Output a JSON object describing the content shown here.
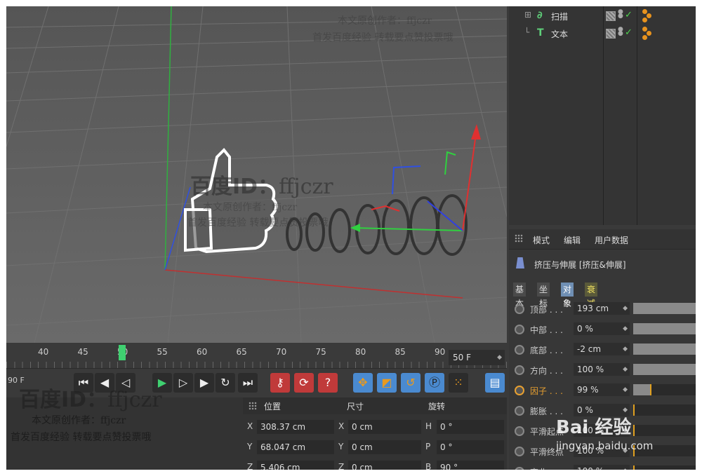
{
  "object_manager": {
    "items": [
      {
        "name": "扫描",
        "icon": "sweep-icon"
      },
      {
        "name": "文本",
        "icon": "text-icon"
      }
    ]
  },
  "attributes": {
    "menu": [
      "模式",
      "编辑",
      "用户数据"
    ],
    "title": "挤压与伸展 [挤压&伸展]",
    "tabs": [
      "基本",
      "坐标",
      "对象",
      "衰减"
    ],
    "active_tab": "对象",
    "params": [
      {
        "label": "顶部 . . .",
        "value": "193 cm"
      },
      {
        "label": "中部 . . .",
        "value": "0 %"
      },
      {
        "label": "底部 . . .",
        "value": "-2 cm"
      },
      {
        "label": "方向 . . .",
        "value": "100 %"
      },
      {
        "label": "因子 . . .",
        "value": "99 %",
        "highlight": true
      },
      {
        "label": "膨胀 . . .",
        "value": "0 %"
      },
      {
        "label": "平滑起点",
        "value": "100 %"
      },
      {
        "label": "平滑终点",
        "value": "100 %"
      },
      {
        "label": "弯曲 . . .",
        "value": "100 %"
      }
    ]
  },
  "timeline": {
    "ticks": [
      "40",
      "45",
      "50",
      "55",
      "60",
      "65",
      "70",
      "75",
      "80",
      "85",
      "90"
    ],
    "current_frame": "50",
    "end_frame": "50 F",
    "left_field": "90 F"
  },
  "coordinates": {
    "headers": [
      "位置",
      "尺寸",
      "旋转"
    ],
    "rows": [
      {
        "pos_axis": "X",
        "pos": "308.37 cm",
        "size_axis": "X",
        "size": "0 cm",
        "rot_axis": "H",
        "rot": "0 °"
      },
      {
        "pos_axis": "Y",
        "pos": "68.047 cm",
        "size_axis": "Y",
        "size": "0 cm",
        "rot_axis": "P",
        "rot": "0 °"
      },
      {
        "pos_axis": "Z",
        "pos": "5.406 cm",
        "size_axis": "Z",
        "size": "0 cm",
        "rot_axis": "B",
        "rot": "90 °"
      }
    ]
  },
  "watermark": {
    "id_label": "百度ID：",
    "id_value": "ffjczr",
    "line1": "本文原创作者：ffjczr",
    "line2": "首发百度经验  转载要点赞投票哦"
  },
  "logo": {
    "brand": "Bai  经验",
    "url": "jingyan.baidu.com"
  },
  "colors": {
    "accent": "#6f8fb4",
    "playhead": "#3fd070",
    "highlight": "#e8a030",
    "x_axis": "#e03030",
    "y_axis": "#30c040",
    "z_axis": "#3050e0"
  }
}
